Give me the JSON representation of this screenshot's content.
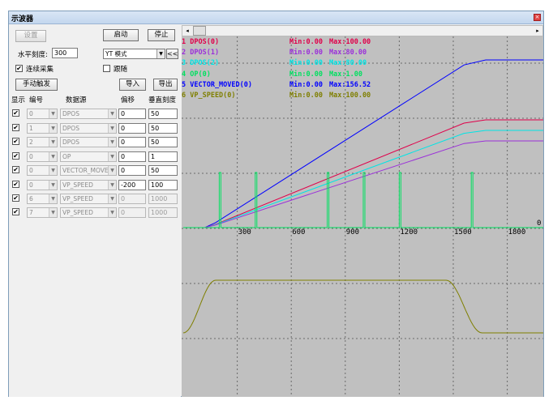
{
  "window": {
    "title": "示波器"
  },
  "controls": {
    "settings_label": "设置",
    "start_label": "启动",
    "stop_label": "停止",
    "hscale_label": "水平刻度:",
    "hscale_value": "300",
    "mode_value": "YT 模式",
    "collapse_label": "<<",
    "continuous_label": "连续采集",
    "continuous_checked": "✔",
    "follow_label": "跟随",
    "manual_trigger_label": "手动触发",
    "import_label": "导入",
    "export_label": "导出"
  },
  "table": {
    "headers": [
      "显示",
      "编号",
      "数据源",
      "偏移",
      "垂直刻度"
    ],
    "rows": [
      {
        "check": "✔",
        "id": "0",
        "source": "DPOS",
        "offset": "0",
        "scale": "50"
      },
      {
        "check": "✔",
        "id": "1",
        "source": "DPOS",
        "offset": "0",
        "scale": "50"
      },
      {
        "check": "✔",
        "id": "2",
        "source": "DPOS",
        "offset": "0",
        "scale": "50"
      },
      {
        "check": "✔",
        "id": "0",
        "source": "OP",
        "offset": "0",
        "scale": "1"
      },
      {
        "check": "✔",
        "id": "0",
        "source": "VECTOR_MOVED",
        "offset": "0",
        "scale": "50"
      },
      {
        "check": "✔",
        "id": "0",
        "source": "VP_SPEED",
        "offset": "-200",
        "scale": "100"
      },
      {
        "check": "✔",
        "id": "6",
        "source": "VP_SPEED",
        "offset": "0",
        "scale": "1000"
      },
      {
        "check": "✔",
        "id": "7",
        "source": "VP_SPEED",
        "offset": "0",
        "scale": "1000"
      }
    ]
  },
  "scrollbar": {
    "left_arrow": "◂",
    "right_arrow": "▸"
  },
  "chart_data": {
    "type": "line",
    "x_ticks": [
      "300",
      "600",
      "900",
      "1200",
      "1500",
      "1800"
    ],
    "x_tick_values": [
      300,
      600,
      900,
      1200,
      1500,
      1800
    ],
    "x_range": [
      0,
      2000
    ],
    "zero_label": "0",
    "grid": true,
    "legend_position": "top-left",
    "series": [
      {
        "label": "1 DPOS(0)",
        "min": "Min:0.00",
        "max": "Max:100.00",
        "color": "#e0004a"
      },
      {
        "label": "2 DPOS(1)",
        "min": "Min:0.00",
        "max": "Max:80.00",
        "color": "#9b30d9"
      },
      {
        "label": "3 DPOS(2)",
        "min": "Min:0.00",
        "max": "Max:80.00",
        "color": "#00e5e5"
      },
      {
        "label": "4 OP(0)",
        "min": "Min:0.00",
        "max": "Max:1.00",
        "color": "#00e060"
      },
      {
        "label": "5 VECTOR_MOVED(0)",
        "min": "Min:0.00",
        "max": "Max:156.52",
        "color": "#0000ff"
      },
      {
        "label": "6 VP_SPEED(0)",
        "min": "Min:0.00",
        "max": "Max:100.00",
        "color": "#7f7f00"
      }
    ]
  }
}
